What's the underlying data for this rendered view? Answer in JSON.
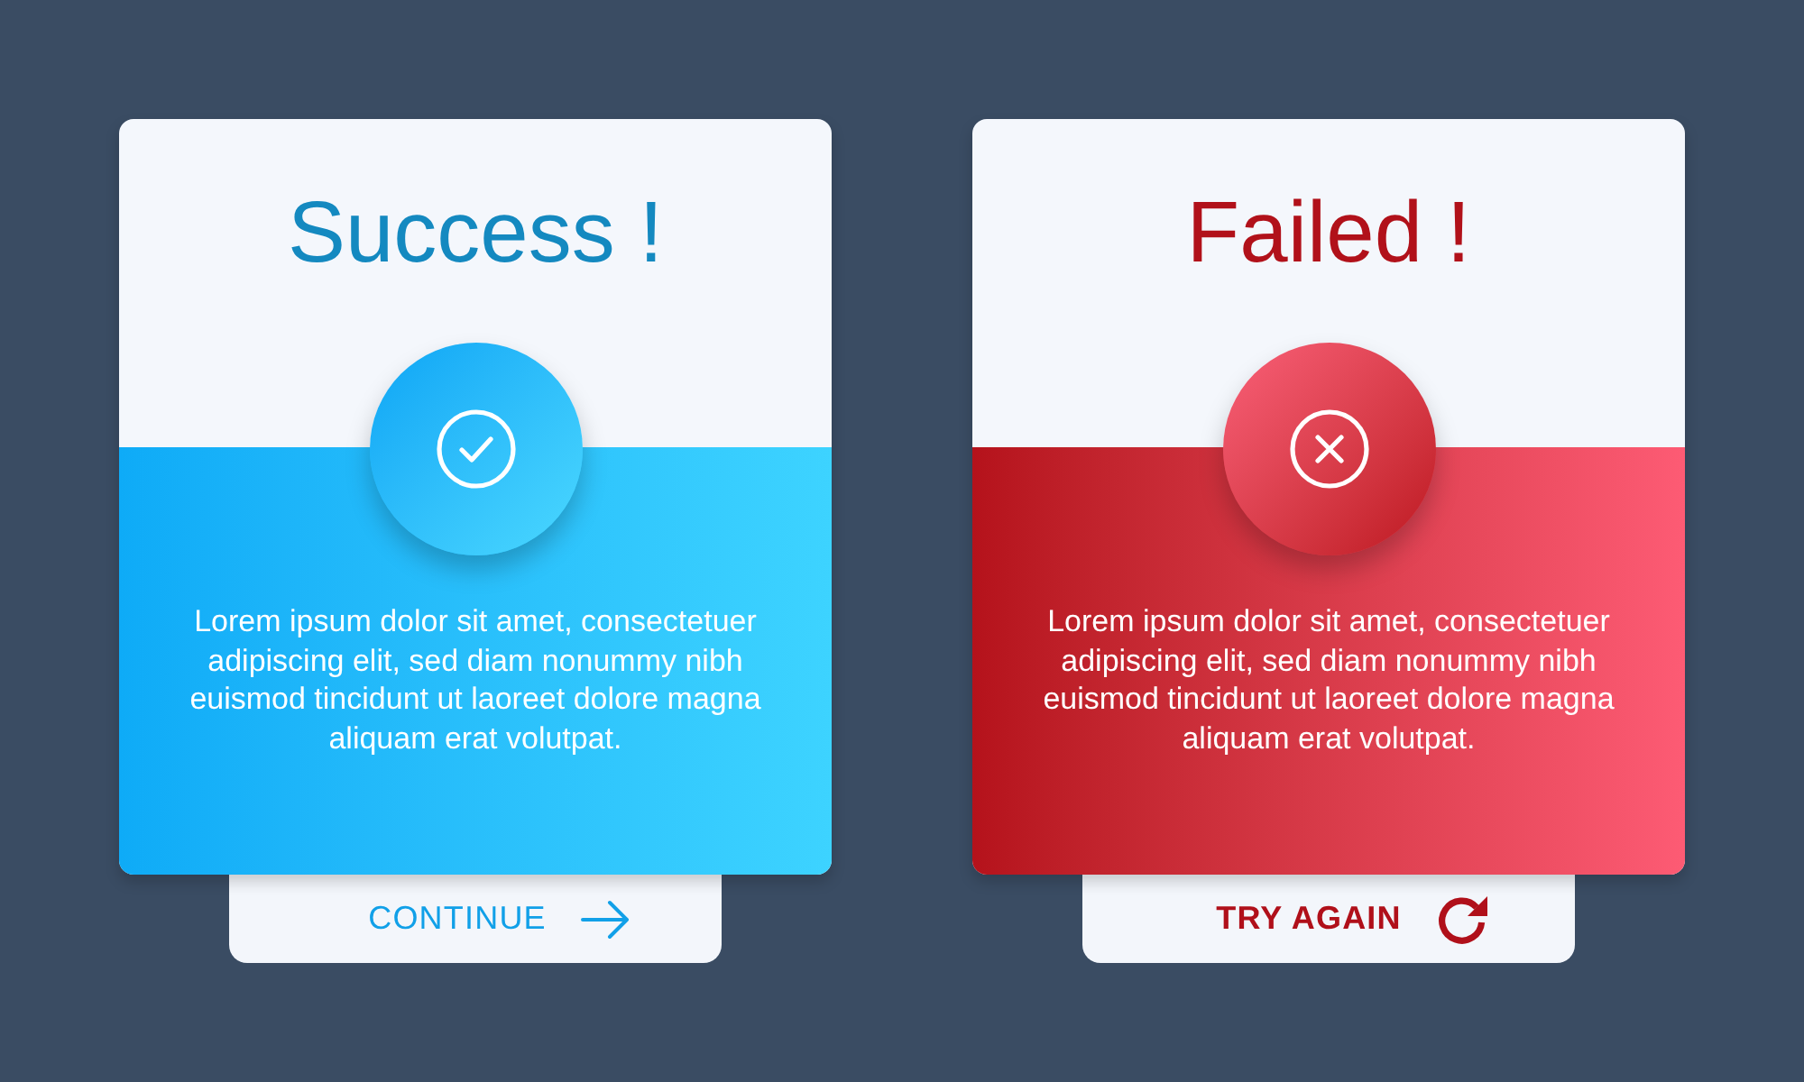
{
  "cards": [
    {
      "kind": "success",
      "title": "Success !",
      "message": "Lorem ipsum dolor sit amet, consectetuer adipiscing elit, sed diam nonummy nibh euismod tincidunt ut laoreet dolore magna aliquam erat volutpat.",
      "button": {
        "label": "CONTINUE"
      }
    },
    {
      "kind": "failed",
      "title": "Failed !",
      "message": "Lorem ipsum dolor sit amet, consectetuer adipiscing elit, sed diam nonummy nibh euismod tincidunt ut laoreet dolore magna aliquam erat volutpat.",
      "button": {
        "label": "TRY AGAIN"
      }
    }
  ]
}
